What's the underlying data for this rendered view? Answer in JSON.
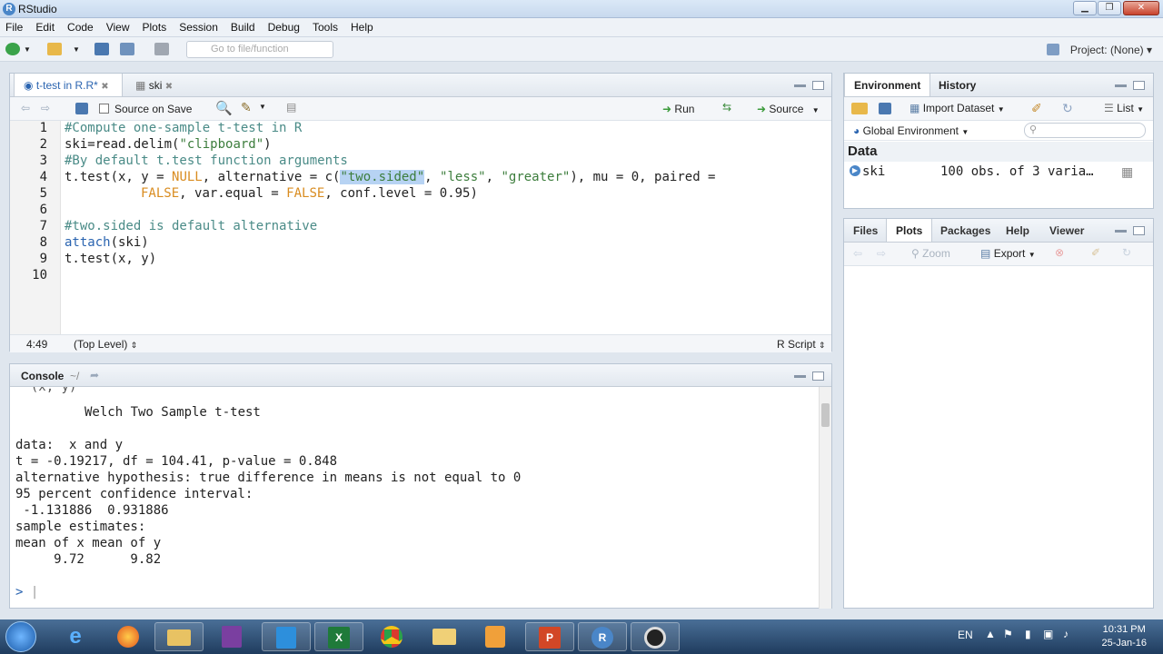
{
  "window": {
    "title": "RStudio"
  },
  "menu": [
    "File",
    "Edit",
    "Code",
    "View",
    "Plots",
    "Session",
    "Build",
    "Debug",
    "Tools",
    "Help"
  ],
  "toolbar": {
    "goto_placeholder": "Go to file/function",
    "project": "Project: (None)"
  },
  "source": {
    "tabs": [
      {
        "label": "t-test in R.R*",
        "active": true
      },
      {
        "label": "ski",
        "active": false
      }
    ],
    "source_on_save": "Source on Save",
    "run": "Run",
    "source_btn": "Source",
    "line_numbers": [
      "1",
      "2",
      "3",
      "4",
      "5",
      "6",
      "7",
      "8",
      "9",
      "10"
    ],
    "lines": {
      "l1": "#Compute one-sample t-test in R",
      "l2a": "ski=read.delim(",
      "l2b": "\"clipboard\"",
      "l2c": ")",
      "l3": "#By default t.test function arguments",
      "l4a": "t.test(x, y = ",
      "l4b": "NULL",
      "l4c": ", alternative = c(",
      "l4d": "\"two.sided\"",
      "l4e": ", ",
      "l4f": "\"less\"",
      "l4g": ", ",
      "l4h": "\"greater\"",
      "l4i": "), mu = 0, paired =",
      "l5a": "FALSE",
      "l5b": ", var.equal = ",
      "l5c": "FALSE",
      "l5d": ", conf.level = 0.95)",
      "l7": "#two.sided is default alternative",
      "l8a": "attach",
      "l8b": "(ski)",
      "l9": "t.test(x, y)"
    },
    "status": {
      "position": "4:49",
      "scope": "(Top Level)",
      "type": "R Script"
    }
  },
  "console": {
    "title": "Console",
    "path": "~/",
    "lines": [
      "Welch Two Sample t-test",
      "data:  x and y",
      "t = -0.19217, df = 104.41, p-value = 0.848",
      "alternative hypothesis: true difference in means is not equal to 0",
      "95 percent confidence interval:",
      " -1.131886  0.931886",
      "sample estimates:",
      "mean of x mean of y",
      "     9.72      9.82"
    ],
    "prompt": ">"
  },
  "environment": {
    "tabs": [
      "Environment",
      "History"
    ],
    "import": "Import Dataset",
    "list": "List",
    "scope": "Global Environment",
    "section": "Data",
    "var_name": "ski",
    "var_value": "100 obs. of 3 varia…"
  },
  "files": {
    "tabs": [
      "Files",
      "Plots",
      "Packages",
      "Help",
      "Viewer"
    ],
    "zoom": "Zoom",
    "export": "Export"
  },
  "taskbar": {
    "lang": "EN",
    "time": "10:31 PM",
    "date": "25-Jan-16"
  },
  "colors": {
    "accent": "#4a86c8",
    "comment": "#4a8b87",
    "string": "#3c7d3c",
    "keyword": "#d98c20",
    "selection": "#b7d3f3"
  }
}
